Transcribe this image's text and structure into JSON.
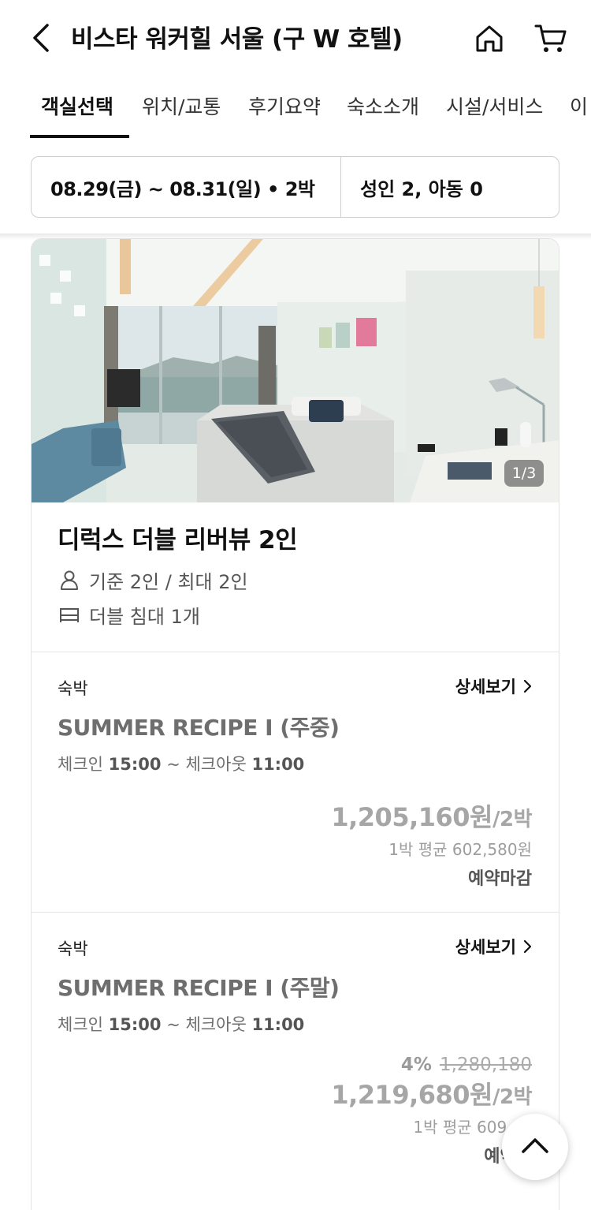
{
  "header": {
    "title": "비스타 워커힐 서울 (구 W 호텔)",
    "icons": {
      "back": "chevron-left-icon",
      "home": "home-icon",
      "cart": "cart-icon"
    }
  },
  "tabs": [
    {
      "label": "객실선택",
      "active": true
    },
    {
      "label": "위치/교통",
      "active": false
    },
    {
      "label": "후기요약",
      "active": false
    },
    {
      "label": "숙소소개",
      "active": false
    },
    {
      "label": "시설/서비스",
      "active": false
    },
    {
      "label": "이",
      "active": false
    }
  ],
  "search": {
    "dates": "08.29(금) ~ 08.31(일) • 2박",
    "guests": "성인 2, 아동 0"
  },
  "room": {
    "photo_counter": "1/3",
    "name": "디럭스 더블 리버뷰 2인",
    "capacity": "기준 2인 / 최대 2인",
    "bed": "더블 침대 1개",
    "icons": {
      "capacity": "person-icon",
      "bed": "bed-icon"
    }
  },
  "plans": [
    {
      "type": "숙박",
      "detail_label": "상세보기",
      "name": "SUMMER RECIPE I (주중)",
      "checkin_label": "체크인",
      "checkin_time": "15:00",
      "checkout_label": "체크아웃",
      "checkout_time": "11:00",
      "price": "1,205,160원",
      "price_unit": "/2박",
      "avg": "1박 평균 602,580원",
      "status": "예약마감"
    },
    {
      "type": "숙박",
      "detail_label": "상세보기",
      "name": "SUMMER RECIPE I (주말)",
      "checkin_label": "체크인",
      "checkin_time": "15:00",
      "checkout_label": "체크아웃",
      "checkout_time": "11:00",
      "discount_pct": "4%",
      "original_price": "1,280,180",
      "price": "1,219,680원",
      "price_unit": "/2박",
      "avg": "1박 평균 609,84",
      "status": "예약마"
    }
  ],
  "colors": {
    "text": "#111111",
    "muted": "#6e6e6e",
    "price_gray": "#a6a6a6",
    "border": "#cfcfcf"
  }
}
